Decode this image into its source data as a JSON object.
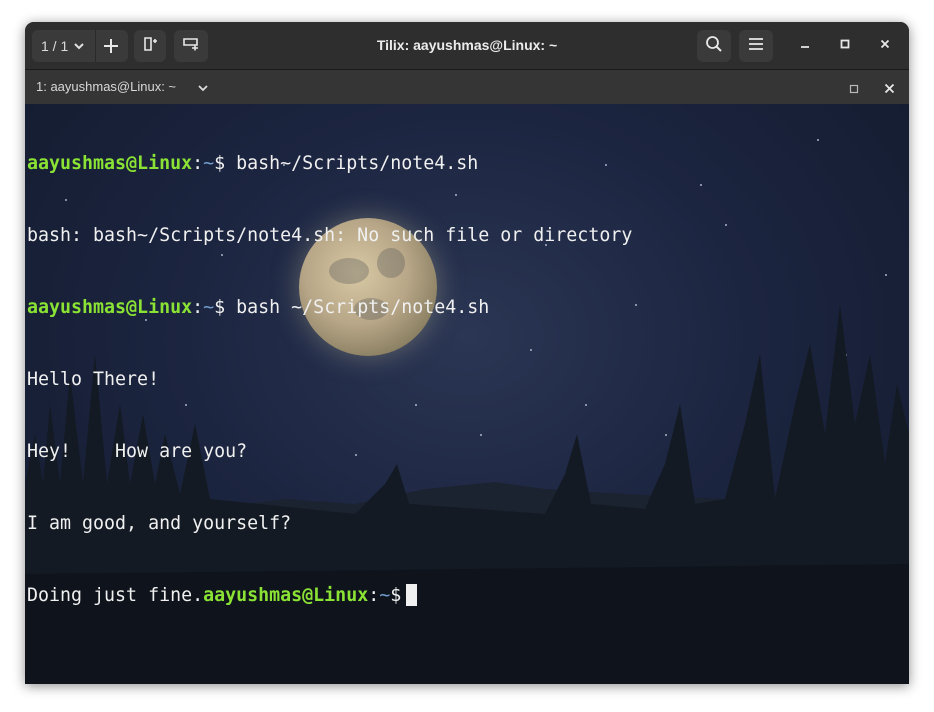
{
  "window": {
    "title": "Tilix: aayushmas@Linux: ~"
  },
  "toolbar": {
    "session_counter": "1 / 1"
  },
  "tab": {
    "label": "1: aayushmas@Linux: ~"
  },
  "terminal": {
    "lines": [
      {
        "user": "aayushmas@Linux",
        "sep": ":",
        "path": "~",
        "prompt": "$ ",
        "text": "bash~/Scripts/note4.sh"
      },
      {
        "text": "bash: bash~/Scripts/note4.sh: No such file or directory"
      },
      {
        "user": "aayushmas@Linux",
        "sep": ":",
        "path": "~",
        "prompt": "$ ",
        "text": "bash ~/Scripts/note4.sh"
      },
      {
        "text": "Hello There!"
      },
      {
        "text": "Hey!    How are you?"
      },
      {
        "text": "I am good, and yourself?"
      },
      {
        "prefix": "Doing just fine.",
        "user": "aayushmas@Linux",
        "sep": ":",
        "path": "~",
        "prompt": "$"
      }
    ]
  },
  "colors": {
    "user": "#8ae234",
    "path": "#729fcf",
    "text": "#f0f0f0"
  },
  "icons": [
    "chevron-down-icon",
    "plus-icon",
    "split-horizontal-icon",
    "split-vertical-icon",
    "search-icon",
    "menu-icon",
    "minimize-icon",
    "maximize-icon",
    "close-icon",
    "terminal-maximize-icon",
    "terminal-close-icon"
  ]
}
